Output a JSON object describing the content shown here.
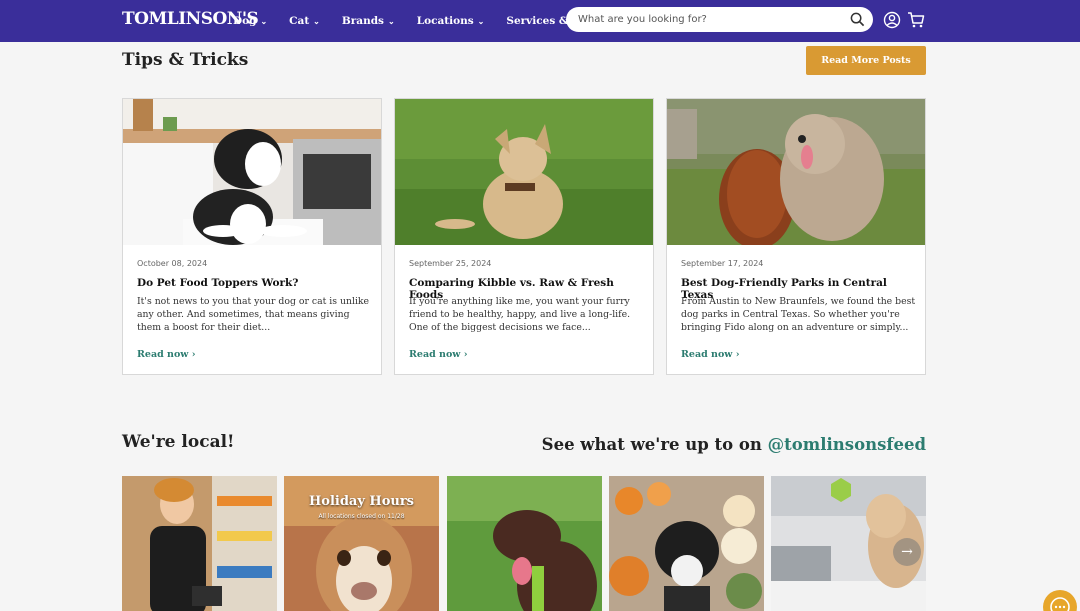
{
  "header": {
    "logo": "TOMLINSON'S",
    "nav": [
      "Dog",
      "Cat",
      "Brands",
      "Locations",
      "Services & Events"
    ],
    "search_placeholder": "What are you looking for?"
  },
  "tips": {
    "title": "Tips & Tricks",
    "read_more": "Read More Posts",
    "cards": [
      {
        "date": "October 08, 2024",
        "title": "Do Pet Food Toppers Work?",
        "excerpt": "It's not news to you that your dog or cat is unlike any other. And sometimes, that means giving them a boost for their diet...",
        "cta": "Read now"
      },
      {
        "date": "September 25, 2024",
        "title": "Comparing Kibble vs. Raw & Fresh Foods",
        "excerpt": "If you're anything like me, you want your furry friend to be healthy, happy, and live a long-life. One of the biggest decisions we face...",
        "cta": "Read now"
      },
      {
        "date": "September 17, 2024",
        "title": "Best Dog-Friendly Parks in Central Texas",
        "excerpt": "From Austin to New Braunfels, we found the best dog parks in Central Texas. So whether you're bringing Fido along on an adventure or simply...",
        "cta": "Read now"
      }
    ]
  },
  "local": {
    "title": "We're local!",
    "see_what": "See what we're up to on ",
    "handle": "@tomlinsonsfeed",
    "holiday_title": "Holiday Hours",
    "holiday_sub": "All locations closed on 11/28"
  },
  "colors": {
    "header_bg": "#3a2e9a",
    "accent_button": "#d99a33",
    "link_teal": "#2c7c70"
  }
}
